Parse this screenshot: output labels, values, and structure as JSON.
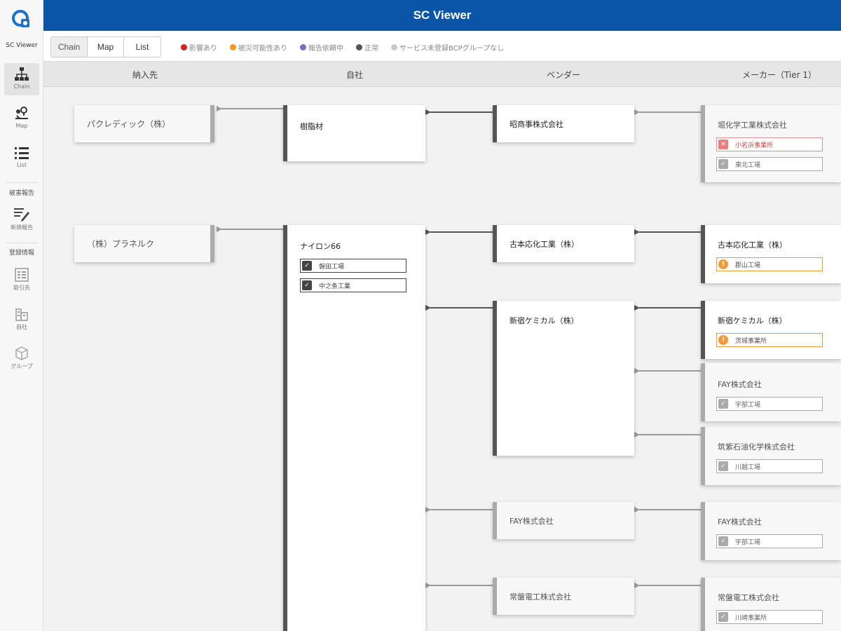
{
  "app": {
    "title": "SC Viewer",
    "sidebar_name": "SC Viewer"
  },
  "sidebar": {
    "items": [
      {
        "label": "Chain",
        "icon": "chain-hierarchy-icon",
        "active": true
      },
      {
        "label": "Map",
        "icon": "map-pin-icon",
        "active": false
      },
      {
        "label": "List",
        "icon": "list-icon",
        "active": false
      }
    ],
    "section_report": "被害報告",
    "report_item": {
      "label": "新規報告",
      "icon": "edit-report-icon"
    },
    "section_registry": "登録情報",
    "registry_items": [
      {
        "label": "取引先",
        "icon": "address-book-icon"
      },
      {
        "label": "自社",
        "icon": "building-icon"
      },
      {
        "label": "グループ",
        "icon": "cube-icon"
      }
    ]
  },
  "toolbar": {
    "views": [
      "Chain",
      "Map",
      "List"
    ],
    "active_view": "Chain",
    "legend": [
      {
        "label": "影響あり",
        "color": "#d81e1e"
      },
      {
        "label": "被災可能性あり",
        "color": "#f39a1e"
      },
      {
        "label": "報告依頼中",
        "color": "#7a6ec8"
      },
      {
        "label": "正常",
        "color": "#555555"
      },
      {
        "label": "サービス未登録BCPグループなし",
        "color": "#c8c8c8"
      }
    ]
  },
  "columns": [
    "納入先",
    "自社",
    "ベンダー",
    "メーカー（Tier 1）"
  ],
  "chain": {
    "customers": [
      {
        "name": "パクレディック（株）"
      },
      {
        "name": "（株）プラネルク"
      }
    ],
    "own": [
      {
        "name": "樹脂材",
        "facilities": []
      },
      {
        "name": "ナイロン66",
        "facilities": [
          {
            "name": "磐田工場",
            "status": "正常"
          },
          {
            "name": "中之条工業",
            "status": "正常"
          }
        ]
      }
    ],
    "vendors": [
      {
        "name": "昭商事株式会社"
      },
      {
        "name": "古本応化工業（株）"
      },
      {
        "name": "新宿ケミカル（株）"
      },
      {
        "name": "FAY株式会社"
      },
      {
        "name": "常盤電工株式会社"
      }
    ],
    "makers": [
      {
        "name": "堀化学工業株式会社",
        "facilities": [
          {
            "name": "小名浜事業所",
            "status": "影響あり"
          },
          {
            "name": "東北工場",
            "status": "正常"
          }
        ]
      },
      {
        "name": "古本応化工業（株）",
        "facilities": [
          {
            "name": "郡山工場",
            "status": "被災可能性あり"
          }
        ]
      },
      {
        "name": "新宿ケミカル（株）",
        "facilities": [
          {
            "name": "茨城事業所",
            "status": "被災可能性あり"
          }
        ]
      },
      {
        "name": "FAY株式会社",
        "facilities": [
          {
            "name": "宇部工場",
            "status": "正常"
          }
        ]
      },
      {
        "name": "筑紫石油化学株式会社",
        "facilities": [
          {
            "name": "川越工場",
            "status": "正常"
          }
        ]
      },
      {
        "name": "FAY株式会社",
        "facilities": [
          {
            "name": "宇部工場",
            "status": "正常"
          }
        ]
      },
      {
        "name": "常盤電工株式会社",
        "facilities": [
          {
            "name": "川崎事業所",
            "status": "正常"
          }
        ]
      }
    ]
  }
}
